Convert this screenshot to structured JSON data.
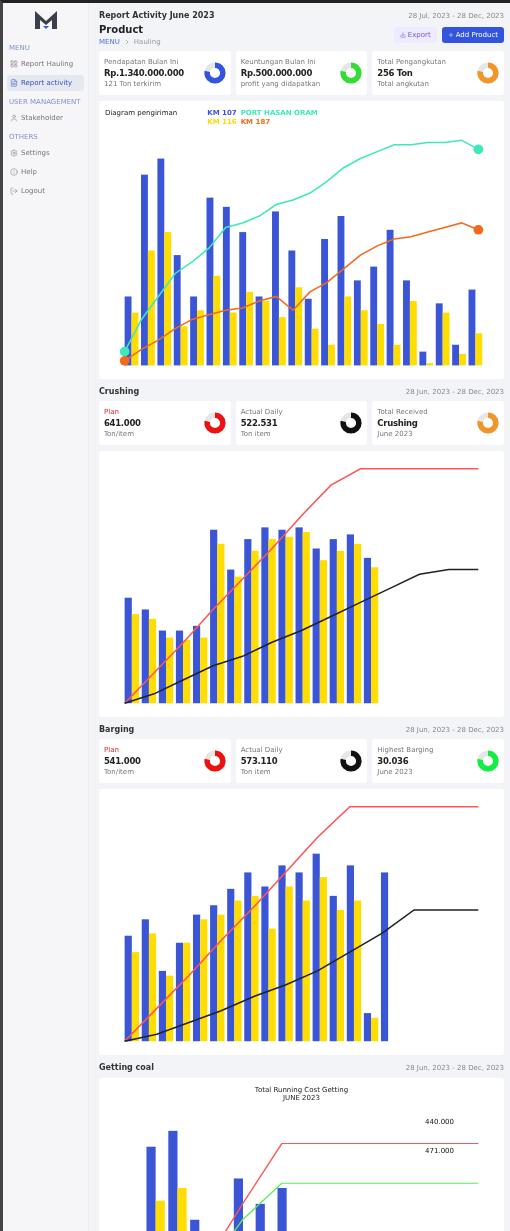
{
  "sidebar": {
    "groups": [
      {
        "label": "MENU",
        "items": [
          {
            "label": "Report Hauling",
            "selected": false
          },
          {
            "label": "Report activity",
            "selected": true
          }
        ]
      },
      {
        "label": "USER MANAGEMENT",
        "items": [
          {
            "label": "Stakeholder",
            "selected": false
          }
        ]
      },
      {
        "label": "OTHERS",
        "items": [
          {
            "label": "Settings",
            "selected": false
          },
          {
            "label": "Help",
            "selected": false
          },
          {
            "label": "Logout",
            "selected": false
          }
        ]
      }
    ]
  },
  "header": {
    "title": "Report Activity June 2023",
    "date_range": "28 Jul, 2023 - 28 Dec, 2023"
  },
  "page": {
    "title": "Product",
    "breadcrumb": [
      "MENU",
      "Hauling"
    ],
    "buttons": [
      {
        "label": "Export",
        "kind": "secondary"
      },
      {
        "label": "Add Product",
        "kind": "primary"
      }
    ]
  },
  "summary_cards": [
    {
      "label": "Pendapatan Bulan Ini",
      "value": "Rp.1.340.000.000",
      "note": "121 Ton terkirim",
      "color": "#3355dd"
    },
    {
      "label": "Keuntungan Bulan Ini",
      "value": "Rp.500.000.000",
      "note": "profit yang didapatkan",
      "color": "#33dd33"
    },
    {
      "label": "Total Pengangkutan",
      "value": "256 Ton",
      "note": "Total angkutan",
      "color": "#f0962a"
    }
  ],
  "delivery_chart": {
    "title": "Diagram pengiriman",
    "legend": [
      {
        "label": "KM 107",
        "color": "#3a55d6"
      },
      {
        "label": "PORT HASAN ORAM",
        "color": "#3ee8b8"
      },
      {
        "label": "KM 116",
        "color": "#ffd900"
      },
      {
        "label": "KM 187",
        "color": "#f26a1b"
      }
    ]
  },
  "sections": [
    {
      "title": "Crushing",
      "date_range": "28 Jun, 2023 - 28 Dec, 2023",
      "kind": "crushing",
      "cards": [
        {
          "kind": "plan",
          "label": "Plan",
          "value": "641.000",
          "note": "Ton/item",
          "color": "#ee1111"
        },
        {
          "kind": "actual",
          "label": "Actual Daily",
          "value": "522.531",
          "note": "Ton item",
          "color": "#111111"
        },
        {
          "kind": "actual",
          "label": "Total Received",
          "value": "Crushing",
          "note": "June 2023",
          "color": "#f0962a"
        }
      ]
    },
    {
      "title": "Barging",
      "date_range": "28 Jun, 2023 - 28 Dec, 2023",
      "kind": "barging",
      "cards": [
        {
          "kind": "plan",
          "label": "Plan",
          "value": "541.000",
          "note": "Ton/item",
          "color": "#ee1111"
        },
        {
          "kind": "actual",
          "label": "Actual Daily",
          "value": "573.110",
          "note": "Ton item",
          "color": "#111111"
        },
        {
          "kind": "actual",
          "label": "Highest Barging",
          "value": "30.036",
          "note": "June 2023",
          "color": "#11ee44"
        }
      ]
    },
    {
      "title": "Getting coal",
      "date_range": "28 Jun, 2023 - 28 Dec, 2023",
      "kind": "getting",
      "chart_title": "Total Running Cost Getting",
      "chart_subtitle": "JUNE 2023",
      "line_labels": [
        "440.000",
        "471.000"
      ]
    }
  ]
}
